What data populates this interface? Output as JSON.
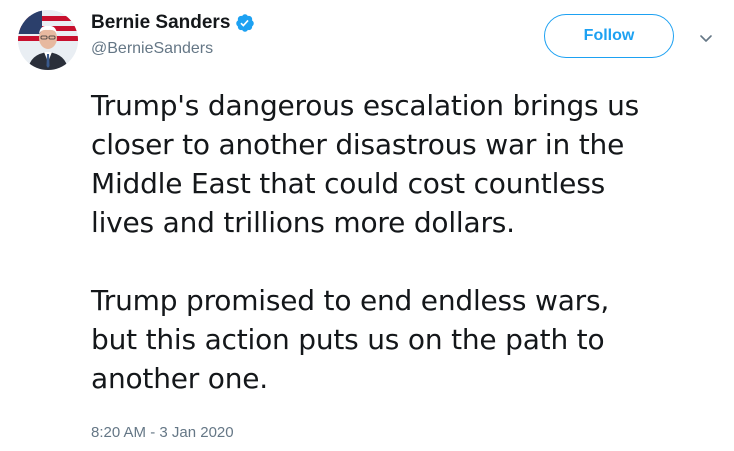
{
  "user": {
    "display_name": "Bernie Sanders",
    "handle": "@BernieSanders",
    "verified": true,
    "avatar_icon": "avatar-icon",
    "verified_icon": "verified-badge-icon"
  },
  "actions": {
    "follow_label": "Follow",
    "menu_icon": "chevron-down-icon"
  },
  "tweet": {
    "paragraphs": [
      "Trump's dangerous escalation brings us\ncloser to another disastrous war in the\nMiddle East that could cost countless\nlives and trillions more dollars.",
      "Trump promised to end endless wars,\nbut this action puts us on the path to\nanother one."
    ],
    "timestamp": "8:20 AM - 3 Jan 2020"
  },
  "colors": {
    "brand_blue": "#1da1f2",
    "text_primary": "#14171a",
    "text_secondary": "#657786"
  }
}
